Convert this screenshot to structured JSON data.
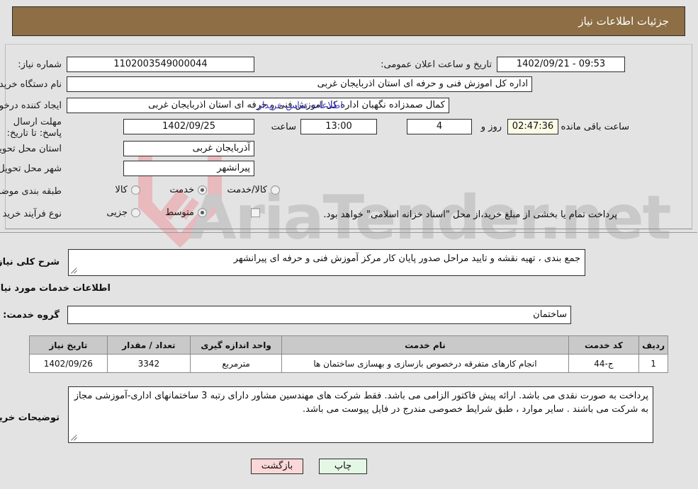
{
  "window": {
    "title": "جزئیات اطلاعات نیاز"
  },
  "watermark": {
    "text": "AriaTender.net",
    "logo": "shield-logo"
  },
  "top_form": {
    "need_number": {
      "label": "شماره نیاز:",
      "value": "1102003549000044"
    },
    "public_announce": {
      "label": "تاریخ و ساعت اعلان عمومی:",
      "value": "1402/09/21 - 09:53"
    },
    "buyer_org": {
      "label": "نام دستگاه خریدار:",
      "value": "اداره کل اموزش فنی و حرفه ای استان اذربایجان غربی"
    },
    "requester": {
      "label": "ایجاد کننده درخواست:",
      "value": "کمال صمدزاده نگهبان اداره کل اموزش فنی و حرفه ای استان اذربایجان غربی"
    },
    "contact_link": "اطلاعات تماس خریدار",
    "deadline": {
      "label": "مهلت ارسال پاسخ: تا تاریخ:",
      "date": "1402/09/25",
      "time_label": "ساعت",
      "time": "13:00",
      "days": "4",
      "days_label": "روز و",
      "countdown": "02:47:36",
      "countdown_label": "ساعت باقی مانده"
    },
    "delivery_province": {
      "label": "استان محل تحویل:",
      "value": "آذربایجان غربی"
    },
    "delivery_city": {
      "label": "شهر محل تحویل:",
      "value": "پیرانشهر"
    },
    "category": {
      "label": "طبقه بندی موضوعی:",
      "options": [
        {
          "label": "کالا",
          "selected": false
        },
        {
          "label": "خدمت",
          "selected": true
        },
        {
          "label": "کالا/خدمت",
          "selected": false
        }
      ]
    },
    "purchase_type": {
      "label": "نوع فرآیند خرید :",
      "options": [
        {
          "label": "جزیی",
          "selected": false
        },
        {
          "label": "متوسط",
          "selected": true
        }
      ],
      "checkbox_label": "پرداخت تمام یا بخشی از مبلغ خرید،از محل \"اسناد خزانه اسلامی\" خواهد بود.",
      "checkbox_checked": false
    }
  },
  "general_need": {
    "label": "شرح کلی نیاز:",
    "value": "جمع بندی ، تهیه نقشه و تایید مراحل صدور پایان کار مرکز آموزش فنی و حرفه ای پیرانشهر"
  },
  "services_section": {
    "heading": "اطلاعات خدمات مورد نیاز",
    "service_group": {
      "label": "گروه خدمت:",
      "value": "ساختمان"
    },
    "table": {
      "columns": [
        "ردیف",
        "کد خدمت",
        "نام خدمت",
        "واحد اندازه گیری",
        "تعداد / مقدار",
        "تاریخ نیاز"
      ],
      "rows": [
        {
          "row": "1",
          "code": "ج-44",
          "name": "انجام کارهای متفرقه درخصوص بازسازی و بهسازی ساختمان ها",
          "unit": "مترمربع",
          "quantity": "3342",
          "date": "1402/09/26"
        }
      ]
    }
  },
  "buyer_notes": {
    "label": "توضیحات خریدار:",
    "value": "پرداخت به صورت نقدی می باشد. ارائه پیش فاکتور الزامی می باشد. فقط شرکت های مهندسین مشاور دارای رتبه 3 ساختمانهای اداری-آموزشی مجاز به شرکت می باشند . سایر موارد ، طبق شرایط خصوصی مندرج در فایل پیوست می باشد."
  },
  "footer": {
    "print_label": "چاپ",
    "back_label": "بازگشت"
  },
  "colors": {
    "title_bar": "#8d6e45",
    "page_bg": "#e3e3e3",
    "link": "#3a3ad0",
    "table_header": "#c9c9c9",
    "print_button": "#e4f6e4",
    "back_button": "#fbd7d7",
    "countdown_bg": "#fbfbe6"
  }
}
